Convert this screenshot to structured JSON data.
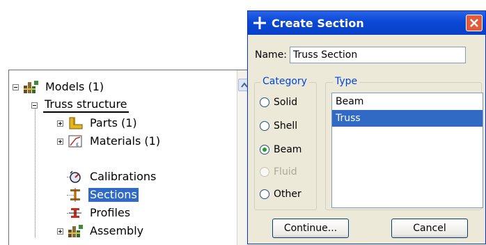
{
  "tree": {
    "nodes": [
      {
        "label": "Models (1)",
        "icon": "models-icon"
      },
      {
        "label": "Truss structure"
      },
      {
        "label": "Parts (1)",
        "icon": "parts-icon"
      },
      {
        "label": "Materials (1)",
        "icon": "materials-icon"
      },
      {
        "label": "Calibrations",
        "icon": "calibrations-icon"
      },
      {
        "label": "Sections",
        "icon": "sections-icon",
        "selected": true
      },
      {
        "label": "Profiles",
        "icon": "profiles-icon"
      },
      {
        "label": "Assembly",
        "icon": "assembly-icon"
      }
    ]
  },
  "dialog": {
    "title": "Create Section",
    "name_label": "Name:",
    "name_value": "Truss Section",
    "category": {
      "legend": "Category",
      "options": [
        "Solid",
        "Shell",
        "Beam",
        "Fluid",
        "Other"
      ],
      "selected": "Beam",
      "disabled": [
        "Fluid"
      ]
    },
    "type": {
      "legend": "Type",
      "items": [
        "Beam",
        "Truss"
      ],
      "selected": "Truss"
    },
    "buttons": {
      "continue": "Continue...",
      "cancel": "Cancel"
    }
  },
  "colors": {
    "selection": "#316ac5",
    "titlebar": "#0a48d6",
    "dialog_bg": "#ece9d8",
    "radio_checked": "#21a121"
  }
}
